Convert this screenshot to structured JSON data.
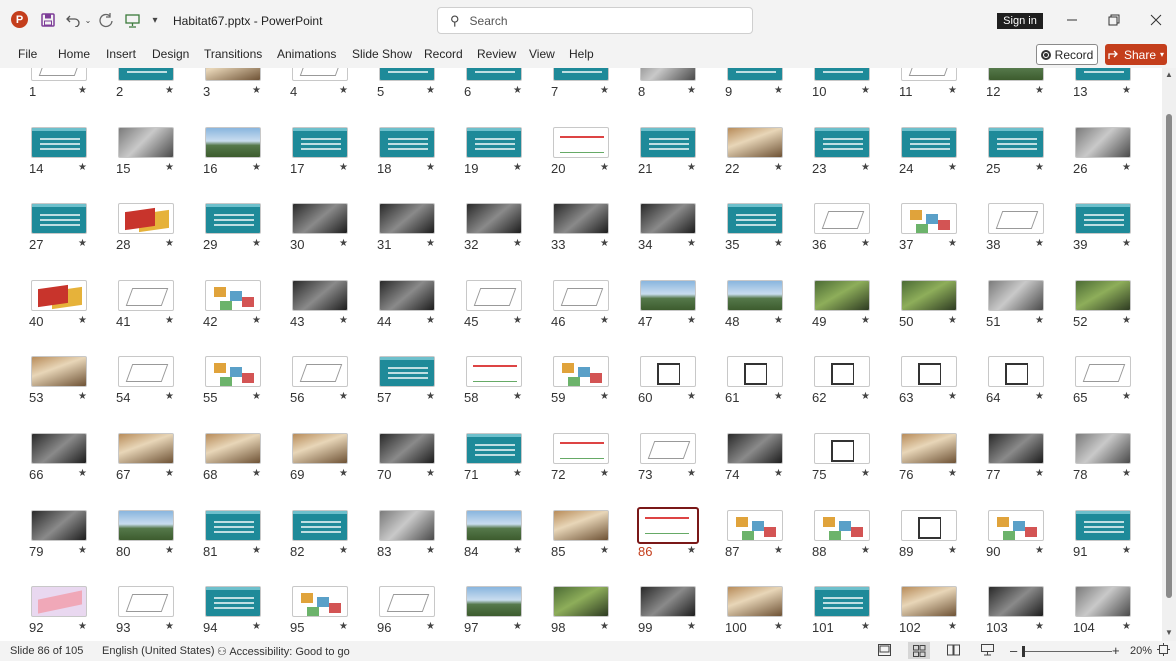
{
  "titlebar": {
    "app_logo": "P",
    "title": "Habitat67.pptx  -  PowerPoint",
    "search_placeholder": "Search",
    "sign_in": "Sign in",
    "icons": [
      "save-icon",
      "undo-icon",
      "redo-icon",
      "present-icon",
      "customize-icon",
      "minimize-icon",
      "restore-icon",
      "close-icon"
    ]
  },
  "ribbon": {
    "tabs": [
      "File",
      "Home",
      "Insert",
      "Design",
      "Transitions",
      "Animations",
      "Slide Show",
      "Record",
      "Review",
      "View",
      "Help"
    ],
    "record_label": "Record",
    "share_label": "Share"
  },
  "sorter": {
    "selected": 86,
    "star": "★",
    "slides": [
      {
        "n": "1",
        "t": "line"
      },
      {
        "n": "2",
        "t": "teal"
      },
      {
        "n": "3",
        "t": "photo-warm"
      },
      {
        "n": "4",
        "t": "line"
      },
      {
        "n": "5",
        "t": "teal"
      },
      {
        "n": "6",
        "t": "teal"
      },
      {
        "n": "7",
        "t": "teal"
      },
      {
        "n": "8",
        "t": "photo"
      },
      {
        "n": "9",
        "t": "teal"
      },
      {
        "n": "10",
        "t": "teal"
      },
      {
        "n": "11",
        "t": "line"
      },
      {
        "n": "12",
        "t": "photo-sky"
      },
      {
        "n": "13",
        "t": "teal"
      },
      {
        "n": "14",
        "t": "teal"
      },
      {
        "n": "15",
        "t": "photo"
      },
      {
        "n": "16",
        "t": "photo-sky"
      },
      {
        "n": "17",
        "t": "teal"
      },
      {
        "n": "18",
        "t": "teal"
      },
      {
        "n": "19",
        "t": "teal"
      },
      {
        "n": "20",
        "t": "diagram"
      },
      {
        "n": "21",
        "t": "teal"
      },
      {
        "n": "22",
        "t": "photo-warm"
      },
      {
        "n": "23",
        "t": "teal"
      },
      {
        "n": "24",
        "t": "teal"
      },
      {
        "n": "25",
        "t": "teal"
      },
      {
        "n": "26",
        "t": "photo"
      },
      {
        "n": "27",
        "t": "teal"
      },
      {
        "n": "28",
        "t": "red"
      },
      {
        "n": "29",
        "t": "teal"
      },
      {
        "n": "30",
        "t": "dark"
      },
      {
        "n": "31",
        "t": "dark"
      },
      {
        "n": "32",
        "t": "dark"
      },
      {
        "n": "33",
        "t": "dark"
      },
      {
        "n": "34",
        "t": "dark"
      },
      {
        "n": "35",
        "t": "teal"
      },
      {
        "n": "36",
        "t": "line"
      },
      {
        "n": "37",
        "t": "colorful"
      },
      {
        "n": "38",
        "t": "line"
      },
      {
        "n": "39",
        "t": "teal"
      },
      {
        "n": "40",
        "t": "red"
      },
      {
        "n": "41",
        "t": "line"
      },
      {
        "n": "42",
        "t": "colorful"
      },
      {
        "n": "43",
        "t": "dark"
      },
      {
        "n": "44",
        "t": "dark"
      },
      {
        "n": "45",
        "t": "line"
      },
      {
        "n": "46",
        "t": "line"
      },
      {
        "n": "47",
        "t": "photo-sky"
      },
      {
        "n": "48",
        "t": "photo-sky"
      },
      {
        "n": "49",
        "t": "photo-green"
      },
      {
        "n": "50",
        "t": "photo-green"
      },
      {
        "n": "51",
        "t": "photo"
      },
      {
        "n": "52",
        "t": "photo-green"
      },
      {
        "n": "53",
        "t": "photo-warm"
      },
      {
        "n": "54",
        "t": "line"
      },
      {
        "n": "55",
        "t": "colorful"
      },
      {
        "n": "56",
        "t": "line"
      },
      {
        "n": "57",
        "t": "teal"
      },
      {
        "n": "58",
        "t": "diagram"
      },
      {
        "n": "59",
        "t": "colorful"
      },
      {
        "n": "60",
        "t": "plan"
      },
      {
        "n": "61",
        "t": "plan"
      },
      {
        "n": "62",
        "t": "plan"
      },
      {
        "n": "63",
        "t": "plan"
      },
      {
        "n": "64",
        "t": "plan"
      },
      {
        "n": "65",
        "t": "line"
      },
      {
        "n": "66",
        "t": "dark"
      },
      {
        "n": "67",
        "t": "photo-warm"
      },
      {
        "n": "68",
        "t": "photo-warm"
      },
      {
        "n": "69",
        "t": "photo-warm"
      },
      {
        "n": "70",
        "t": "dark"
      },
      {
        "n": "71",
        "t": "teal"
      },
      {
        "n": "72",
        "t": "diagram"
      },
      {
        "n": "73",
        "t": "line"
      },
      {
        "n": "74",
        "t": "dark"
      },
      {
        "n": "75",
        "t": "plan"
      },
      {
        "n": "76",
        "t": "photo-warm"
      },
      {
        "n": "77",
        "t": "dark"
      },
      {
        "n": "78",
        "t": "photo"
      },
      {
        "n": "79",
        "t": "dark"
      },
      {
        "n": "80",
        "t": "photo-sky"
      },
      {
        "n": "81",
        "t": "teal"
      },
      {
        "n": "82",
        "t": "teal"
      },
      {
        "n": "83",
        "t": "photo"
      },
      {
        "n": "84",
        "t": "photo-sky"
      },
      {
        "n": "85",
        "t": "photo-warm"
      },
      {
        "n": "86",
        "t": "diagram"
      },
      {
        "n": "87",
        "t": "colorful"
      },
      {
        "n": "88",
        "t": "colorful"
      },
      {
        "n": "89",
        "t": "plan"
      },
      {
        "n": "90",
        "t": "colorful"
      },
      {
        "n": "91",
        "t": "teal"
      },
      {
        "n": "92",
        "t": "pink"
      },
      {
        "n": "93",
        "t": "line"
      },
      {
        "n": "94",
        "t": "teal"
      },
      {
        "n": "95",
        "t": "colorful"
      },
      {
        "n": "96",
        "t": "line"
      },
      {
        "n": "97",
        "t": "photo-sky"
      },
      {
        "n": "98",
        "t": "photo-green"
      },
      {
        "n": "99",
        "t": "dark"
      },
      {
        "n": "100",
        "t": "photo-warm"
      },
      {
        "n": "101",
        "t": "teal"
      },
      {
        "n": "102",
        "t": "photo-warm"
      },
      {
        "n": "103",
        "t": "dark"
      },
      {
        "n": "104",
        "t": "photo"
      }
    ]
  },
  "statusbar": {
    "slide_info": "Slide 86 of 105",
    "language": "English (United States)",
    "accessibility": "Accessibility: Good to go",
    "zoom": "20%",
    "zoom_minus": "–",
    "zoom_plus": "+"
  }
}
